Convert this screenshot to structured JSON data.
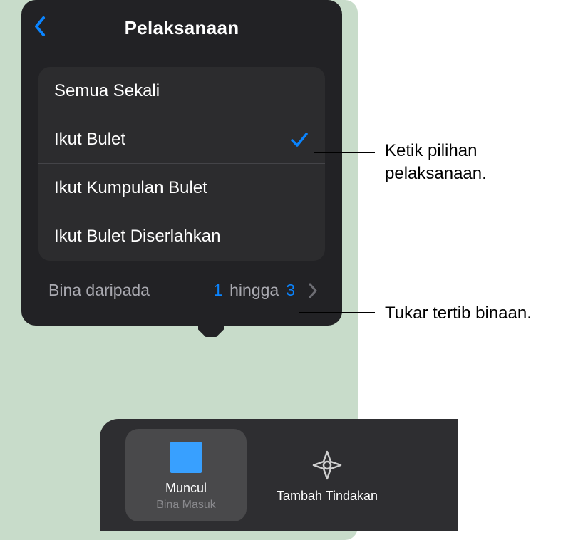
{
  "popover": {
    "title": "Pelaksanaan",
    "options": [
      {
        "label": "Semua Sekali",
        "selected": false
      },
      {
        "label": "Ikut Bulet",
        "selected": true
      },
      {
        "label": "Ikut Kumpulan Bulet",
        "selected": false
      },
      {
        "label": "Ikut Bulet Diserlahkan",
        "selected": false
      }
    ],
    "build": {
      "label": "Bina daripada",
      "from": "1",
      "separator": "hingga",
      "to": "3"
    }
  },
  "bottom": {
    "thumbs": [
      {
        "title": "Muncul",
        "subtitle": "Bina Masuk",
        "selected": true,
        "icon": "square"
      },
      {
        "title": "Tambah Tindakan",
        "subtitle": "",
        "selected": false,
        "icon": "target"
      }
    ]
  },
  "callouts": {
    "delivery": "Ketik pilihan pelaksanaan.",
    "order": "Tukar tertib binaan."
  }
}
